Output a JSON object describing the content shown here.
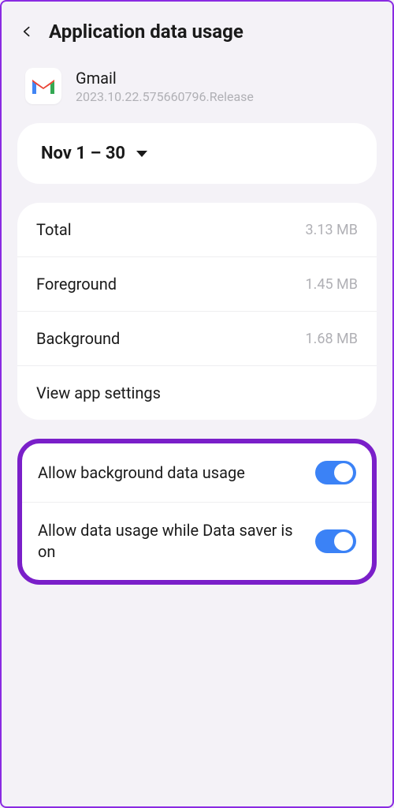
{
  "header": {
    "title": "Application data usage"
  },
  "app": {
    "name": "Gmail",
    "version": "2023.10.22.575660796.Release"
  },
  "dateRange": {
    "label": "Nov 1 – 30"
  },
  "stats": {
    "total": {
      "label": "Total",
      "value": "3.13 MB"
    },
    "foreground": {
      "label": "Foreground",
      "value": "1.45 MB"
    },
    "background": {
      "label": "Background",
      "value": "1.68 MB"
    },
    "settingsLink": "View app settings"
  },
  "toggles": {
    "bg": {
      "label": "Allow background data usage",
      "on": true
    },
    "saver": {
      "label": "Allow data usage while Data saver is on",
      "on": true
    }
  }
}
